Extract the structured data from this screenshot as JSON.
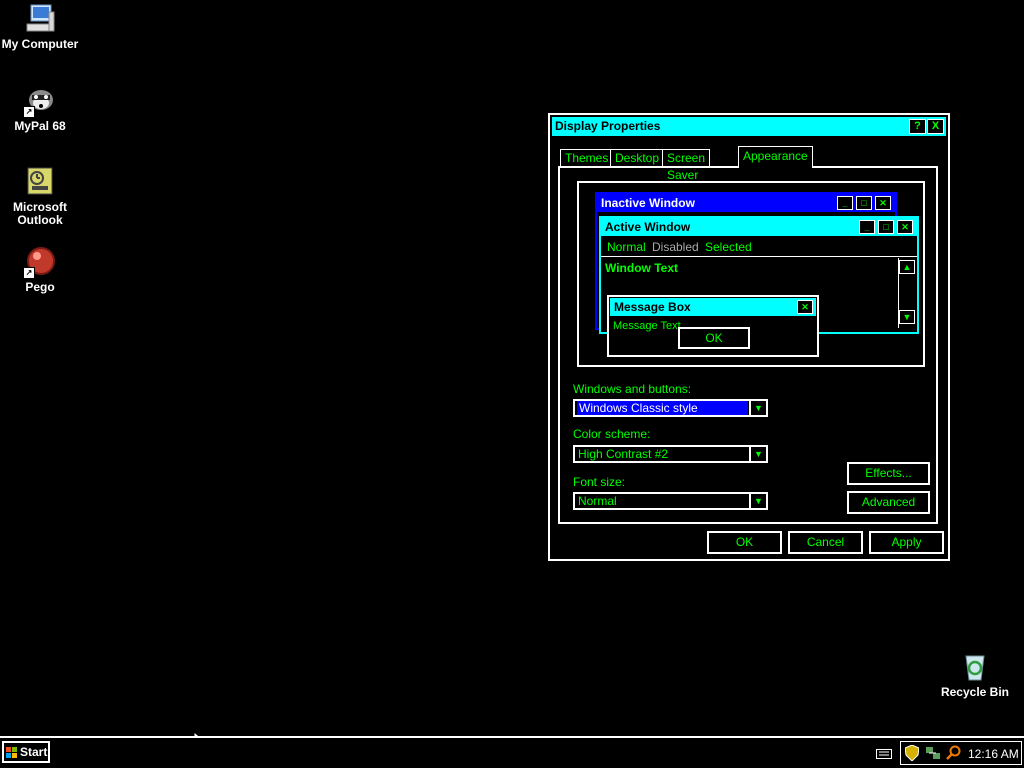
{
  "desktop": {
    "icons": {
      "my_computer": "My Computer",
      "mypal": "MyPal 68",
      "outlook_line1": "Microsoft",
      "outlook_line2": "Outlook",
      "pego": "Pego",
      "recycle_bin": "Recycle Bin"
    }
  },
  "dialog": {
    "title": "Display Properties",
    "help_glyph": "?",
    "close_glyph": "X",
    "tabs": [
      "Themes",
      "Desktop",
      "Screen Saver",
      "Appearance"
    ],
    "active_tab": "Appearance",
    "preview": {
      "inactive_title": "Inactive Window",
      "active_title": "Active Window",
      "menu": [
        "Normal",
        "Disabled",
        "Selected"
      ],
      "window_text": "Window Text",
      "message_box_title": "Message Box",
      "message_text": "Message Text",
      "ok_label": "OK"
    },
    "windows_and_buttons": {
      "label": "Windows and buttons:",
      "value": "Windows Classic style"
    },
    "color_scheme": {
      "label": "Color scheme:",
      "value": "High Contrast #2"
    },
    "font_size": {
      "label": "Font size:",
      "value": "Normal"
    },
    "effects_label": "Effects...",
    "advanced_label": "Advanced",
    "ok_label": "OK",
    "cancel_label": "Cancel",
    "apply_label": "Apply"
  },
  "taskbar": {
    "start_label": "Start",
    "clock": "12:16 AM"
  },
  "colors": {
    "background": "#000000",
    "text": "#00ff00",
    "active_title": "#00ffff",
    "inactive_title": "#0000ff",
    "selection": "#0000ff"
  }
}
